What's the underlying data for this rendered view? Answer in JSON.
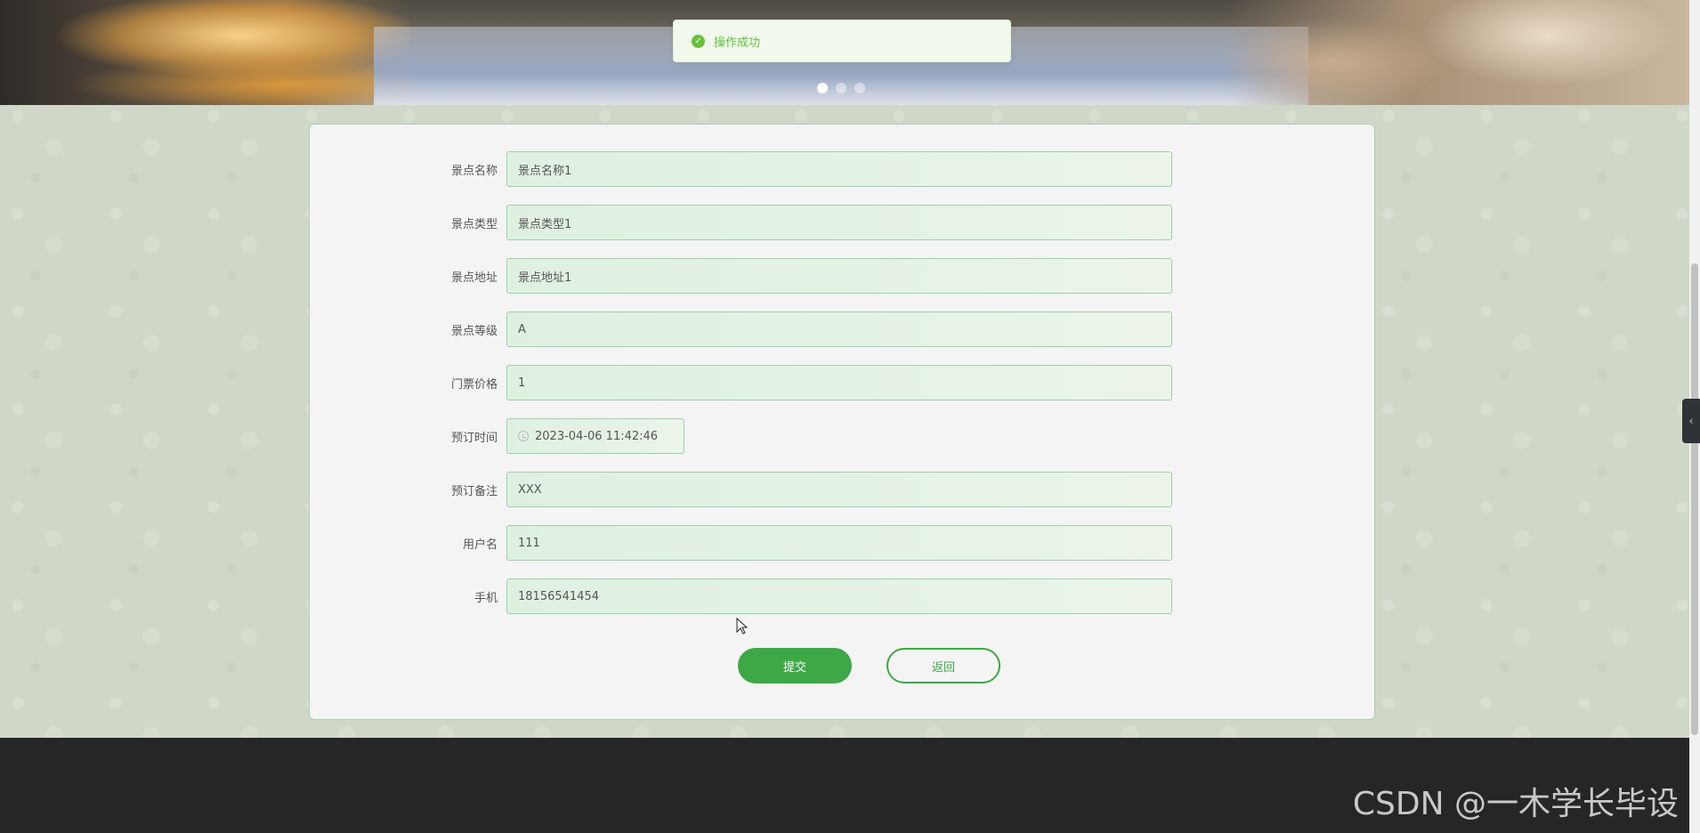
{
  "toast": {
    "icon": "check-circle-icon",
    "message": "操作成功"
  },
  "carousel": {
    "slides": 3,
    "active_index": 0
  },
  "form": {
    "fields": [
      {
        "label": "景点名称",
        "value": "景点名称1"
      },
      {
        "label": "景点类型",
        "value": "景点类型1"
      },
      {
        "label": "景点地址",
        "value": "景点地址1"
      },
      {
        "label": "景点等级",
        "value": "A"
      },
      {
        "label": "门票价格",
        "value": "1"
      },
      {
        "label": "预订时间",
        "value": "2023-04-06 11:42:46"
      },
      {
        "label": "预订备注",
        "value": "XXX"
      },
      {
        "label": "用户名",
        "value": "111"
      },
      {
        "label": "手机",
        "value": "18156541454"
      }
    ],
    "submit_label": "提交",
    "back_label": "返回"
  },
  "footer": {
    "watermark": "CSDN @一木学长毕设"
  },
  "colors": {
    "accent": "#3ea846",
    "toast_text": "#67c23a",
    "footer_bg": "#262626"
  }
}
